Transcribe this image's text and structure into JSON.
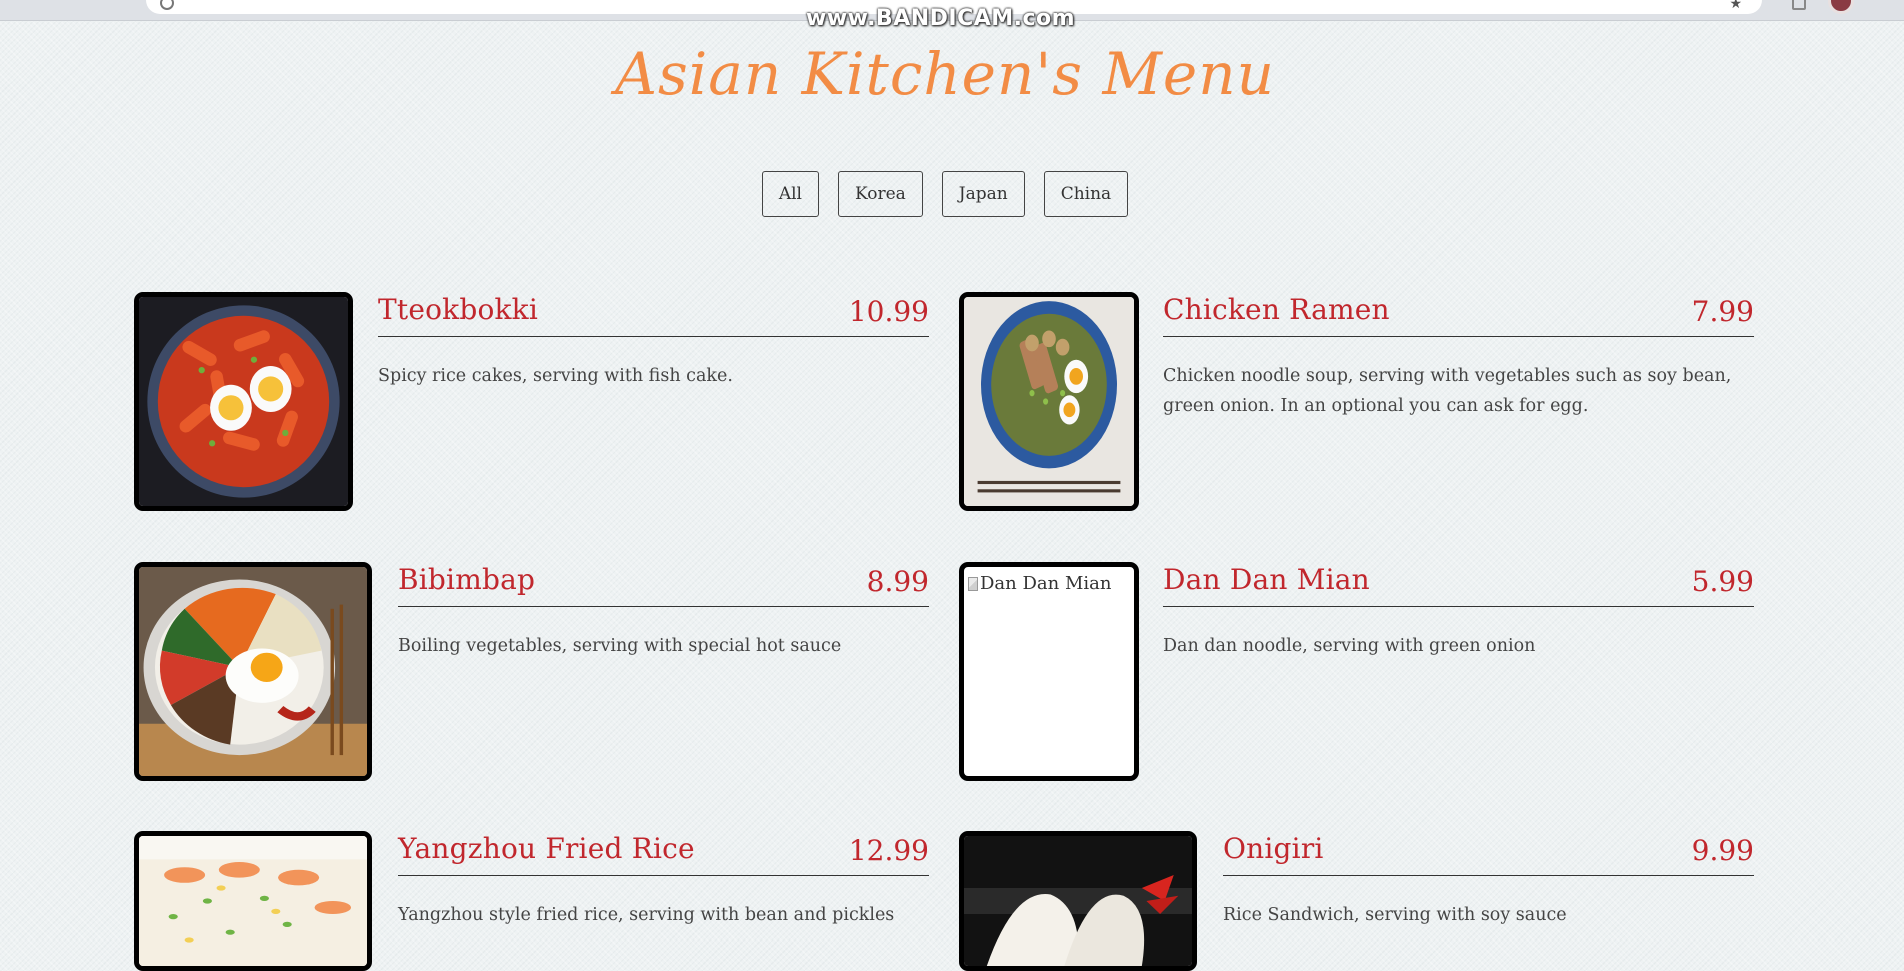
{
  "watermark": "www.BANDICAM.com",
  "page_title": "Asian Kitchen's Menu",
  "filters": [
    "All",
    "Korea",
    "Japan",
    "China"
  ],
  "items": [
    {
      "name": "Tteokbokki",
      "price": "10.99",
      "desc": "Spicy rice cakes, serving with fish cake.",
      "image_alt": "Tteokbokki"
    },
    {
      "name": "Chicken Ramen",
      "price": "7.99",
      "desc": "Chicken noodle soup, serving with vegetables such as soy bean, green onion. In an optional you can ask for egg.",
      "image_alt": "Chicken Ramen"
    },
    {
      "name": "Bibimbap",
      "price": "8.99",
      "desc": "Boiling vegetables, serving with special hot sauce",
      "image_alt": "Bibimbap"
    },
    {
      "name": "Dan Dan Mian",
      "price": "5.99",
      "desc": "Dan dan noodle, serving with green onion",
      "image_alt": "Dan Dan Mian"
    },
    {
      "name": "Yangzhou Fried Rice",
      "price": "12.99",
      "desc": "Yangzhou style fried rice, serving with bean and pickles",
      "image_alt": "Yangzhou Fried Rice"
    },
    {
      "name": "Onigiri",
      "price": "9.99",
      "desc": "Rice Sandwich, serving with soy sauce",
      "image_alt": "Onigiri"
    }
  ]
}
